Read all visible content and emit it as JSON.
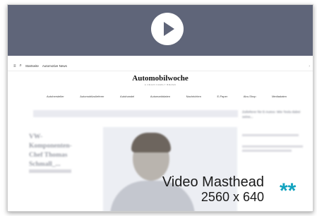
{
  "video": {
    "play_icon": "play-icon",
    "bar_color": "#5f6579"
  },
  "site": {
    "menu_icon": "hamburger-menu-icon",
    "search_icon": "search-icon",
    "nav_links": [
      "Startseite",
      "Automotive News"
    ],
    "brand": "Automobilwoche",
    "tagline": "A CRAIN FAMILY BRAND",
    "categories": [
      "Autohersteller",
      "Automobilzulieferer",
      "Autohandel",
      "Automarktdaten",
      "Nachrichten",
      "E-Paper",
      "Abo-Shop",
      "Mediadaten"
    ]
  },
  "article": {
    "title_lines": [
      "VW-",
      "Komponenten-",
      "Chef Thomas",
      "Schmall_..."
    ],
    "side_headline": "Zulieferer für E-Autos: Wie Tesla dabei seine..."
  },
  "caption": {
    "title": "Video Masthead",
    "size": "2560 x 640",
    "marker": "**",
    "marker_color": "#12a3bf"
  }
}
